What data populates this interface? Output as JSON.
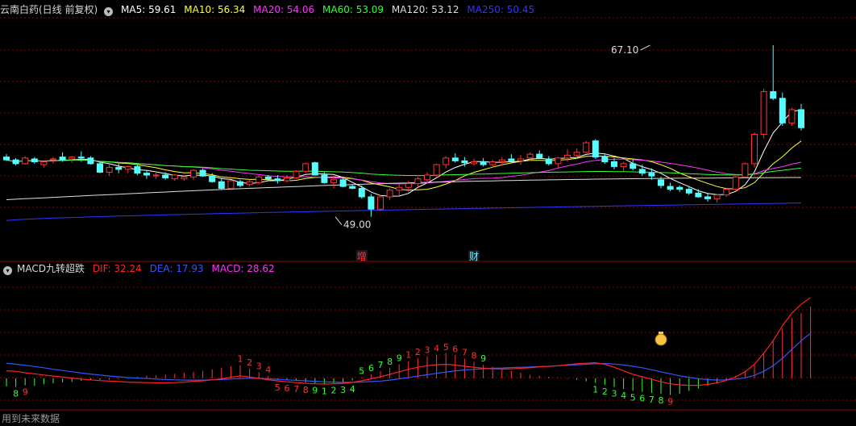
{
  "header": {
    "title": "云南白药(日线 前复权)",
    "ma": [
      {
        "label": "MA5: 59.61",
        "color": "#ffffff"
      },
      {
        "label": "MA10: 56.34",
        "color": "#ffff33"
      },
      {
        "label": "MA20: 54.06",
        "color": "#ff33ff"
      },
      {
        "label": "MA60: 53.09",
        "color": "#33ff33"
      },
      {
        "label": "MA120: 53.12",
        "color": "#dddddd"
      },
      {
        "label": "MA250: 50.45",
        "color": "#3333ff"
      }
    ]
  },
  "sub_header": {
    "title": "MACD九转超跌",
    "items": [
      {
        "label": "DIF: 32.24",
        "color": "#ff2222"
      },
      {
        "label": "DEA: 17.93",
        "color": "#3355ff"
      },
      {
        "label": "MACD: 28.62",
        "color": "#ff33ff"
      }
    ]
  },
  "footer_text": "用到未来数据",
  "colors": {
    "up": "#ff3333",
    "down": "#55ffff",
    "grid": "#8b0000"
  },
  "chart_data": [
    {
      "type": "candlestick",
      "title": "云南白药(日线 前复权)",
      "ylim": [
        46.5,
        70
      ],
      "annotations": [
        {
          "text": "67.10",
          "index": 69,
          "price": 67.1
        },
        {
          "text": "49.00",
          "index": 35,
          "price": 49.0
        }
      ],
      "markers": [
        {
          "text": "增",
          "index": 38,
          "color": "#ff3333"
        },
        {
          "text": "财",
          "index": 50,
          "color": "#55ffff"
        }
      ],
      "ohlc": [
        [
          55.3,
          55.6,
          54.9,
          55.0
        ],
        [
          55.0,
          55.2,
          54.4,
          54.6
        ],
        [
          54.6,
          55.4,
          54.5,
          55.2
        ],
        [
          55.1,
          55.3,
          54.6,
          54.8
        ],
        [
          54.5,
          54.9,
          54.2,
          54.8
        ],
        [
          55.0,
          55.3,
          54.6,
          55.1
        ],
        [
          55.3,
          55.8,
          54.8,
          55.0
        ],
        [
          55.1,
          55.4,
          54.7,
          55.3
        ],
        [
          55.3,
          55.9,
          54.8,
          55.2
        ],
        [
          55.2,
          55.4,
          54.5,
          54.6
        ],
        [
          54.6,
          54.8,
          53.6,
          53.7
        ],
        [
          53.7,
          54.5,
          53.3,
          54.2
        ],
        [
          54.2,
          54.6,
          53.6,
          54.0
        ],
        [
          54.0,
          54.4,
          53.6,
          54.3
        ],
        [
          54.3,
          54.5,
          53.4,
          53.6
        ],
        [
          53.6,
          53.9,
          53.0,
          53.4
        ],
        [
          53.4,
          53.8,
          53.0,
          53.4
        ],
        [
          53.4,
          53.7,
          52.9,
          53.1
        ],
        [
          53.0,
          53.5,
          52.8,
          53.4
        ],
        [
          53.0,
          53.4,
          52.8,
          53.2
        ],
        [
          53.2,
          54.0,
          52.9,
          53.9
        ],
        [
          53.9,
          54.1,
          53.2,
          53.3
        ],
        [
          53.3,
          53.6,
          52.6,
          52.7
        ],
        [
          52.7,
          53.1,
          51.9,
          52.0
        ],
        [
          52.0,
          52.9,
          51.8,
          52.8
        ],
        [
          52.7,
          52.9,
          52.1,
          52.3
        ],
        [
          52.4,
          52.9,
          52.2,
          52.7
        ],
        [
          52.6,
          53.3,
          52.4,
          53.2
        ],
        [
          53.2,
          53.4,
          52.8,
          53.0
        ],
        [
          53.0,
          53.4,
          52.5,
          52.8
        ],
        [
          52.8,
          53.4,
          52.6,
          53.1
        ],
        [
          53.1,
          53.9,
          53.0,
          53.8
        ],
        [
          53.8,
          54.7,
          53.6,
          54.6
        ],
        [
          54.7,
          54.8,
          53.4,
          53.4
        ],
        [
          53.4,
          53.7,
          52.5,
          52.6
        ],
        [
          52.6,
          53.3,
          52.0,
          52.9
        ],
        [
          52.9,
          53.1,
          52.1,
          52.2
        ],
        [
          52.2,
          52.4,
          51.9,
          52.0
        ],
        [
          52.0,
          52.3,
          50.9,
          51.1
        ],
        [
          51.1,
          51.4,
          49.0,
          49.8
        ],
        [
          49.8,
          51.3,
          49.6,
          51.1
        ],
        [
          51.1,
          52.0,
          50.8,
          51.8
        ],
        [
          51.8,
          52.4,
          51.2,
          52.1
        ],
        [
          52.1,
          52.8,
          51.6,
          52.5
        ],
        [
          52.5,
          53.2,
          52.2,
          53.0
        ],
        [
          52.9,
          53.7,
          52.6,
          53.4
        ],
        [
          53.4,
          54.6,
          53.2,
          54.5
        ],
        [
          54.5,
          55.4,
          54.1,
          55.2
        ],
        [
          55.2,
          55.7,
          54.7,
          54.9
        ],
        [
          54.9,
          55.3,
          54.3,
          54.7
        ],
        [
          54.6,
          55.1,
          54.4,
          54.8
        ],
        [
          54.8,
          55.2,
          54.3,
          54.5
        ],
        [
          54.5,
          55.0,
          54.2,
          54.8
        ],
        [
          54.8,
          55.3,
          54.4,
          55.0
        ],
        [
          55.1,
          55.6,
          54.7,
          54.9
        ],
        [
          54.9,
          55.5,
          54.5,
          55.1
        ],
        [
          55.2,
          55.8,
          54.9,
          55.6
        ],
        [
          55.6,
          56.0,
          55.1,
          55.2
        ],
        [
          55.1,
          55.4,
          54.4,
          54.6
        ],
        [
          54.6,
          55.3,
          54.2,
          55.2
        ],
        [
          55.2,
          56.1,
          54.8,
          55.5
        ],
        [
          55.5,
          56.2,
          55.2,
          55.8
        ],
        [
          55.8,
          57.0,
          55.7,
          56.8
        ],
        [
          57.0,
          57.2,
          55.1,
          55.3
        ],
        [
          55.3,
          55.6,
          54.6,
          54.8
        ],
        [
          54.8,
          55.2,
          54.0,
          54.3
        ],
        [
          54.3,
          54.8,
          53.8,
          54.6
        ],
        [
          54.6,
          55.0,
          53.9,
          54.1
        ],
        [
          54.0,
          54.5,
          53.3,
          53.6
        ],
        [
          53.6,
          54.1,
          52.9,
          53.3
        ],
        [
          52.9,
          53.2,
          52.0,
          52.3
        ],
        [
          52.2,
          52.6,
          51.7,
          51.9
        ],
        [
          52.1,
          52.3,
          51.6,
          51.9
        ],
        [
          51.9,
          52.2,
          51.3,
          51.5
        ],
        [
          51.5,
          51.9,
          51.0,
          51.1
        ],
        [
          51.1,
          51.5,
          50.6,
          50.9
        ],
        [
          50.9,
          51.4,
          50.5,
          51.3
        ],
        [
          51.3,
          52.0,
          51.1,
          51.9
        ],
        [
          51.9,
          53.3,
          51.7,
          53.2
        ],
        [
          53.2,
          54.7,
          53.1,
          54.6
        ],
        [
          54.6,
          57.9,
          54.2,
          57.7
        ],
        [
          57.7,
          62.5,
          57.3,
          62.2
        ],
        [
          62.2,
          67.1,
          61.3,
          61.5
        ],
        [
          61.5,
          62.1,
          58.6,
          58.9
        ],
        [
          58.9,
          60.5,
          58.6,
          60.3
        ],
        [
          60.3,
          60.9,
          58.1,
          58.4
        ]
      ]
    },
    {
      "type": "bar",
      "title": "MACD九转超跌",
      "series_names": [
        "DIF",
        "DEA",
        "MACD"
      ],
      "ylim": [
        -10,
        35
      ],
      "macd": [
        -3.2,
        -3.4,
        -2.8,
        -3.0,
        -2.4,
        -2.0,
        -1.6,
        -1.4,
        -1.0,
        -0.8,
        -0.6,
        -0.5,
        -0.3,
        -0.2,
        0.6,
        1.0,
        1.2,
        1.5,
        1.8,
        2.2,
        2.6,
        3.0,
        3.6,
        4.2,
        4.8,
        5.2,
        3.8,
        2.4,
        1.0,
        -0.4,
        -0.8,
        -1.0,
        -1.6,
        -2.0,
        -2.4,
        -2.0,
        -1.8,
        -0.8,
        0.4,
        1.6,
        2.8,
        4.2,
        5.6,
        6.8,
        8.0,
        8.8,
        9.4,
        10.0,
        9.2,
        7.8,
        6.6,
        5.4,
        4.6,
        3.8,
        3.0,
        2.2,
        1.4,
        1.0,
        0.6,
        0.2,
        -0.2,
        -0.6,
        -1.2,
        -1.8,
        -2.6,
        -3.4,
        -4.2,
        -5.0,
        -5.4,
        -5.8,
        -6.2,
        -6.6,
        -6.2,
        -5.0,
        -4.0,
        -3.0,
        -2.0,
        -0.6,
        1.0,
        3.0,
        5.8,
        10.0,
        15.0,
        20.0,
        24.0,
        26.0,
        28.6
      ],
      "dif": [
        3.0,
        2.8,
        2.2,
        1.8,
        1.3,
        0.9,
        0.5,
        0.1,
        -0.3,
        -0.6,
        -0.9,
        -1.1,
        -1.3,
        -1.5,
        -1.6,
        -1.7,
        -1.8,
        -1.8,
        -1.7,
        -1.5,
        -1.2,
        -1.0,
        -0.6,
        -0.2,
        0.4,
        1.0,
        0.5,
        0.0,
        -0.6,
        -1.0,
        -1.4,
        -1.7,
        -2.0,
        -2.2,
        -2.3,
        -2.2,
        -2.0,
        -1.6,
        -1.0,
        -0.2,
        0.6,
        1.6,
        2.6,
        3.6,
        4.4,
        5.0,
        5.4,
        5.6,
        5.3,
        4.8,
        4.4,
        4.0,
        3.8,
        3.7,
        3.8,
        4.0,
        4.2,
        4.6,
        4.8,
        5.0,
        5.4,
        5.8,
        6.0,
        6.2,
        5.6,
        4.4,
        3.0,
        1.6,
        0.6,
        -0.4,
        -1.4,
        -2.2,
        -2.6,
        -2.8,
        -2.8,
        -2.4,
        -1.8,
        -0.8,
        0.6,
        2.6,
        5.6,
        10.0,
        15.0,
        21.0,
        26.0,
        29.5,
        32.2
      ],
      "dea": [
        6.0,
        5.6,
        5.2,
        4.7,
        4.2,
        3.6,
        3.1,
        2.6,
        2.1,
        1.7,
        1.3,
        0.9,
        0.6,
        0.3,
        0.1,
        -0.1,
        -0.3,
        -0.5,
        -0.6,
        -0.7,
        -0.7,
        -0.7,
        -0.6,
        -0.5,
        -0.3,
        -0.1,
        0.0,
        0.0,
        -0.2,
        -0.4,
        -0.6,
        -0.8,
        -1.0,
        -1.2,
        -1.4,
        -1.5,
        -1.6,
        -1.6,
        -1.5,
        -1.3,
        -1.1,
        -0.7,
        -0.2,
        0.3,
        0.9,
        1.4,
        2.0,
        2.5,
        3.0,
        3.3,
        3.6,
        3.8,
        4.0,
        4.1,
        4.3,
        4.4,
        4.5,
        4.7,
        4.8,
        5.0,
        5.2,
        5.4,
        5.6,
        5.8,
        5.9,
        5.7,
        5.3,
        4.8,
        4.2,
        3.4,
        2.6,
        1.8,
        1.0,
        0.4,
        -0.2,
        -0.5,
        -0.7,
        -0.6,
        -0.3,
        0.2,
        1.2,
        2.8,
        5.0,
        8.0,
        11.5,
        15.0,
        17.9
      ],
      "td_labels": [
        {
          "index": 1,
          "text": "8",
          "color": "#33ff33"
        },
        {
          "index": 2,
          "text": "9",
          "color": "#ff3333"
        },
        {
          "index": 25,
          "text": "1",
          "color": "#ff3333"
        },
        {
          "index": 26,
          "text": "2",
          "color": "#ff3333"
        },
        {
          "index": 27,
          "text": "3",
          "color": "#ff3333"
        },
        {
          "index": 28,
          "text": "4",
          "color": "#ff3333"
        },
        {
          "index": 29,
          "text": "5",
          "color": "#ff3333"
        },
        {
          "index": 30,
          "text": "6",
          "color": "#ff3333"
        },
        {
          "index": 31,
          "text": "7",
          "color": "#ff3333"
        },
        {
          "index": 32,
          "text": "8",
          "color": "#ff3333"
        },
        {
          "index": 33,
          "text": "9",
          "color": "#33ff33"
        },
        {
          "index": 34,
          "text": "1",
          "color": "#33ff33"
        },
        {
          "index": 35,
          "text": "2",
          "color": "#33ff33"
        },
        {
          "index": 36,
          "text": "3",
          "color": "#33ff33"
        },
        {
          "index": 37,
          "text": "4",
          "color": "#33ff33"
        },
        {
          "index": 38,
          "text": "5",
          "color": "#33ff33"
        },
        {
          "index": 39,
          "text": "6",
          "color": "#33ff33"
        },
        {
          "index": 40,
          "text": "7",
          "color": "#33ff33"
        },
        {
          "index": 41,
          "text": "8",
          "color": "#33ff33"
        },
        {
          "index": 42,
          "text": "9",
          "color": "#33ff33"
        },
        {
          "index": 43,
          "text": "1",
          "color": "#ff3333"
        },
        {
          "index": 44,
          "text": "2",
          "color": "#ff3333"
        },
        {
          "index": 45,
          "text": "3",
          "color": "#ff3333"
        },
        {
          "index": 46,
          "text": "4",
          "color": "#ff3333"
        },
        {
          "index": 47,
          "text": "5",
          "color": "#ff3333"
        },
        {
          "index": 48,
          "text": "6",
          "color": "#ff3333"
        },
        {
          "index": 49,
          "text": "7",
          "color": "#ff3333"
        },
        {
          "index": 50,
          "text": "8",
          "color": "#ff3333"
        },
        {
          "index": 51,
          "text": "9",
          "color": "#33ff33"
        },
        {
          "index": 63,
          "text": "1",
          "color": "#33ff33"
        },
        {
          "index": 64,
          "text": "2",
          "color": "#33ff33"
        },
        {
          "index": 65,
          "text": "3",
          "color": "#33ff33"
        },
        {
          "index": 66,
          "text": "4",
          "color": "#33ff33"
        },
        {
          "index": 67,
          "text": "5",
          "color": "#33ff33"
        },
        {
          "index": 68,
          "text": "6",
          "color": "#33ff33"
        },
        {
          "index": 69,
          "text": "7",
          "color": "#33ff33"
        },
        {
          "index": 70,
          "text": "8",
          "color": "#33ff33"
        },
        {
          "index": 71,
          "text": "9",
          "color": "#ff3333"
        }
      ],
      "icon": {
        "name": "money-bag-icon",
        "index": 70
      }
    }
  ]
}
